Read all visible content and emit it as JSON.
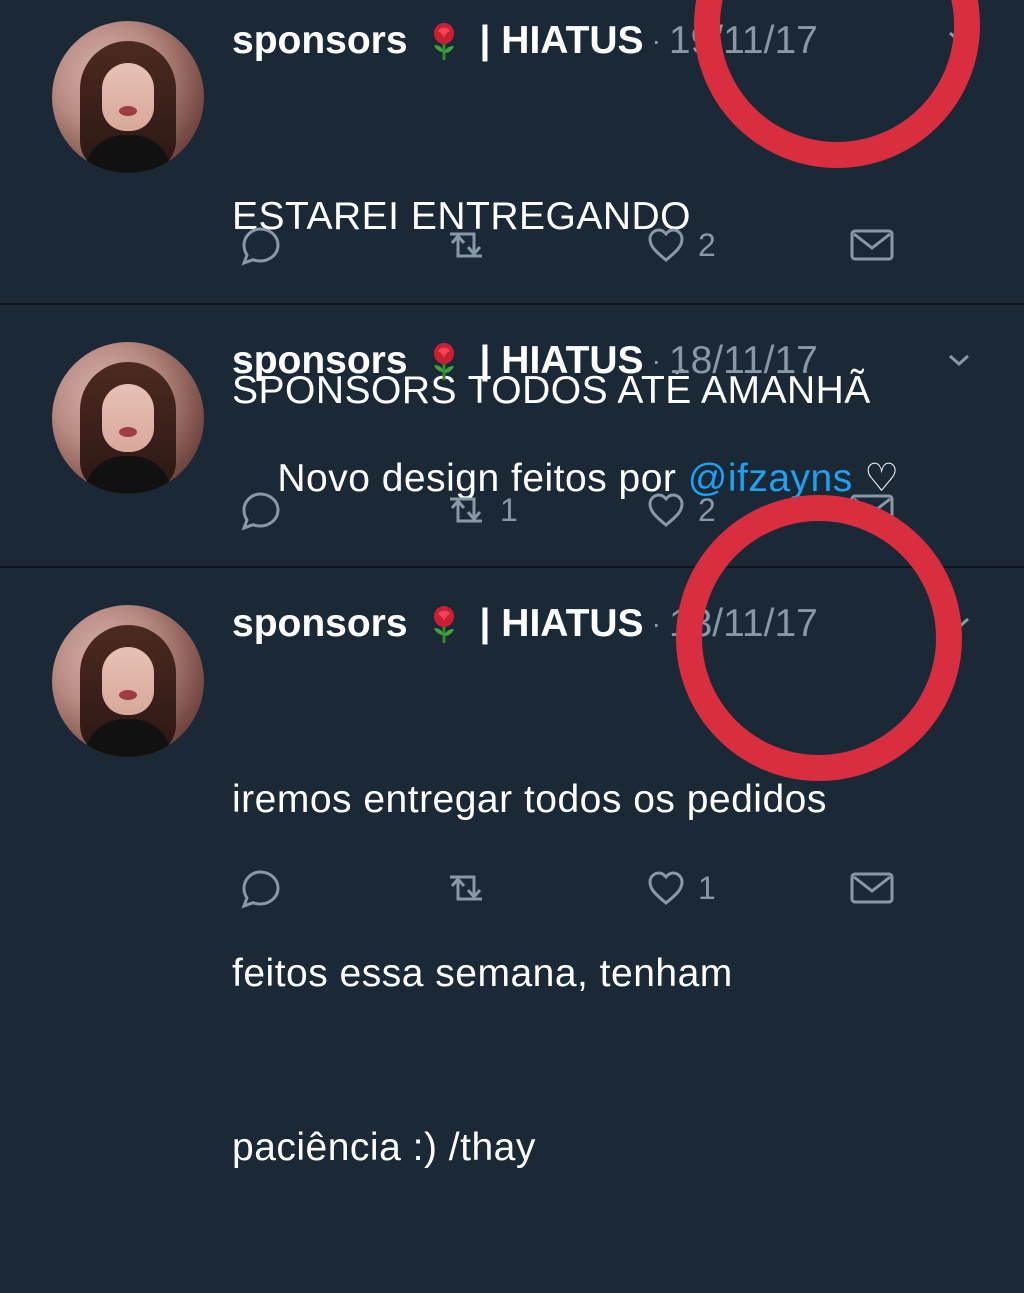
{
  "tweets": [
    {
      "name": "sponsors",
      "handle": "| HIATUS",
      "dot": "·",
      "date": "19/11/17",
      "text_parts": [
        "ESTAREI ENTREGANDO",
        "SPONSORS TODOS ATÉ AMANHÃ"
      ],
      "reply_count": "",
      "retweet_count": "",
      "like_count": "2"
    },
    {
      "name": "sponsors",
      "handle": "| HIATUS",
      "dot": "·",
      "date": "18/11/17",
      "text_before_link": "Novo design feitos por ",
      "link": "@ifzayns",
      "text_after_link": " ♡",
      "reply_count": "",
      "retweet_count": "1",
      "like_count": "2"
    },
    {
      "name": "sponsors",
      "handle": "| HIATUS",
      "dot": "·",
      "date": "13/11/17",
      "text_lines": [
        "iremos entregar todos os pedidos",
        "feitos essa semana, tenham",
        "paciência :) /thay"
      ],
      "reply_count": "",
      "retweet_count": "",
      "like_count": "1"
    }
  ],
  "icons": {
    "avatar": "avatar",
    "rose": "rose-icon",
    "chevron": "chevron-down-icon",
    "reply": "reply-icon",
    "retweet": "retweet-icon",
    "like": "heart-icon",
    "message": "mail-icon"
  },
  "colors": {
    "background": "#1b2836",
    "divider": "#0f151c",
    "muted": "#8899a6",
    "link": "#1da1f2",
    "annotation": "#d92d40"
  }
}
